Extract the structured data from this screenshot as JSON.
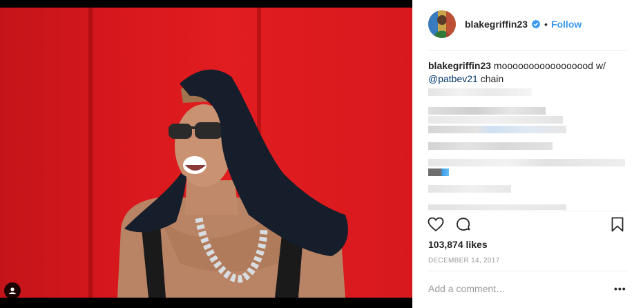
{
  "post": {
    "username": "blakegriffin23",
    "follow_label": "Follow",
    "dot": "•",
    "caption_user": "blakegriffin23",
    "caption_text": " mooooooooooooooood w/",
    "caption_mention": "@patbev21",
    "caption_tail": " chain",
    "likes": "103,874 likes",
    "date": "DECEMBER 14, 2017",
    "comment_placeholder": "Add a comment…",
    "more": "•••"
  },
  "icons": {
    "verified": "verified-badge-icon",
    "like": "heart-icon",
    "comment": "comment-icon",
    "save": "bookmark-icon",
    "tag": "user-tag-icon"
  },
  "colors": {
    "accent": "#3897f0",
    "mention": "#003569",
    "muted": "#999999",
    "photo_red": "#d7181d"
  }
}
